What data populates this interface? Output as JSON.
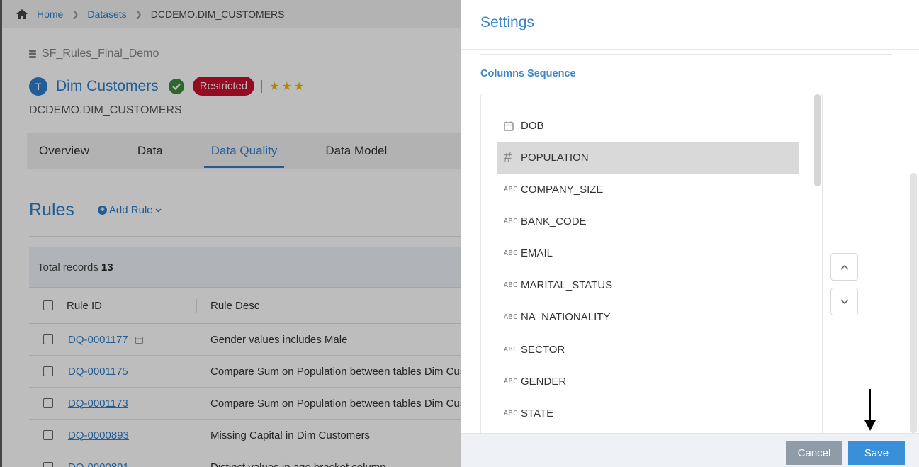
{
  "breadcrumb": {
    "home": "Home",
    "datasets": "Datasets",
    "current": "DCDEMO.DIM_CUSTOMERS"
  },
  "dataset": {
    "database": "SF_Rules_Final_Demo",
    "avatar_letter": "T",
    "title": "Dim Customers",
    "badge": "Restricted",
    "stars": "★★★",
    "code": "DCDEMO.DIM_CUSTOMERS"
  },
  "tabs": [
    {
      "label": "Overview"
    },
    {
      "label": "Data"
    },
    {
      "label": "Data Quality"
    },
    {
      "label": "Data Model"
    }
  ],
  "rules": {
    "title": "Rules",
    "add_label": "Add Rule",
    "total_label": "Total records",
    "total_count": "13",
    "headers": {
      "id": "Rule ID",
      "desc": "Rule Desc"
    },
    "rows": [
      {
        "id": "DQ-0001177",
        "desc": "Gender values includes Male"
      },
      {
        "id": "DQ-0001175",
        "desc": "Compare Sum on Population between tables Dim Customers"
      },
      {
        "id": "DQ-0001173",
        "desc": "Compare Sum on Population between tables Dim Customers"
      },
      {
        "id": "DQ-0000893",
        "desc": "Missing Capital in Dim Customers"
      },
      {
        "id": "DQ-0000891",
        "desc": "Distinct values in age bracket column"
      }
    ]
  },
  "settings": {
    "title": "Settings",
    "section_label": "Columns Sequence",
    "columns": [
      {
        "name": "DOB",
        "type": "date"
      },
      {
        "name": "POPULATION",
        "type": "number",
        "selected": true
      },
      {
        "name": "COMPANY_SIZE",
        "type": "text"
      },
      {
        "name": "BANK_CODE",
        "type": "text"
      },
      {
        "name": "EMAIL",
        "type": "text"
      },
      {
        "name": "MARITAL_STATUS",
        "type": "text"
      },
      {
        "name": "NA_NATIONALITY",
        "type": "text"
      },
      {
        "name": "SECTOR",
        "type": "text"
      },
      {
        "name": "GENDER",
        "type": "text"
      },
      {
        "name": "STATE",
        "type": "text"
      }
    ],
    "type_labels": {
      "text": "ABC",
      "number": "#"
    },
    "cancel_label": "Cancel",
    "save_label": "Save"
  },
  "colors": {
    "accent": "#2f7fc9",
    "restricted": "#c8102e",
    "verified": "#3d8b3d",
    "star": "#f0b400",
    "save_button": "#3a8fd9",
    "cancel_button": "#8f9ba6"
  }
}
